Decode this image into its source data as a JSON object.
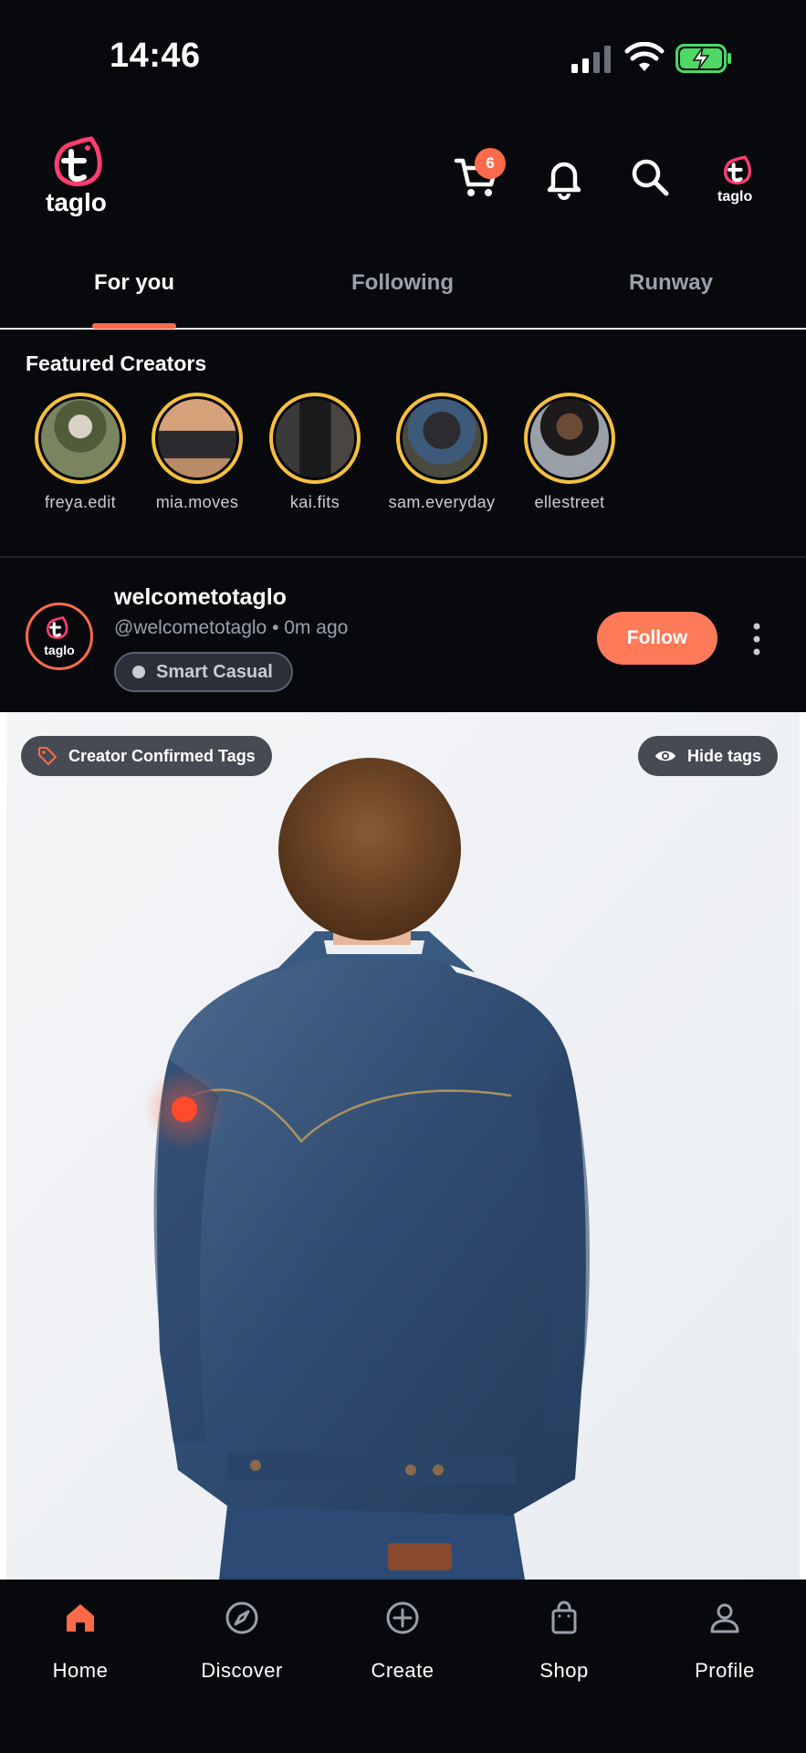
{
  "status_bar": {
    "time": "14:46"
  },
  "header": {
    "logo_text": "taglo",
    "cart_count": "6",
    "icons": [
      "cart-icon",
      "bell-icon",
      "search-icon",
      "profile-logo-icon"
    ]
  },
  "tabs": [
    {
      "label": "For you",
      "active": true
    },
    {
      "label": "Following",
      "active": false
    },
    {
      "label": "Runway",
      "active": false
    }
  ],
  "featured": {
    "title": "Featured Creators",
    "creators": [
      {
        "name": "freya.edit"
      },
      {
        "name": "mia.moves"
      },
      {
        "name": "kai.fits"
      },
      {
        "name": "sam.everyday"
      },
      {
        "name": "ellestreet"
      }
    ]
  },
  "post": {
    "username": "welcometotaglo",
    "meta": "@welcometotaglo • 0m ago",
    "style_tag": "Smart Casual",
    "follow_label": "Follow",
    "confirmed_tags_label": "Creator Confirmed Tags",
    "hide_tags_label": "Hide tags"
  },
  "bottom_nav": [
    {
      "label": "Home",
      "icon": "home-icon",
      "active": true
    },
    {
      "label": "Discover",
      "icon": "compass-icon",
      "active": false
    },
    {
      "label": "Create",
      "icon": "plus-circle-icon",
      "active": false
    },
    {
      "label": "Shop",
      "icon": "shopping-bag-icon",
      "active": false
    },
    {
      "label": "Profile",
      "icon": "person-icon",
      "active": false
    }
  ],
  "colors": {
    "accent": "#ff6b4a",
    "background": "#08090d",
    "story_ring": "#f5c13d"
  }
}
